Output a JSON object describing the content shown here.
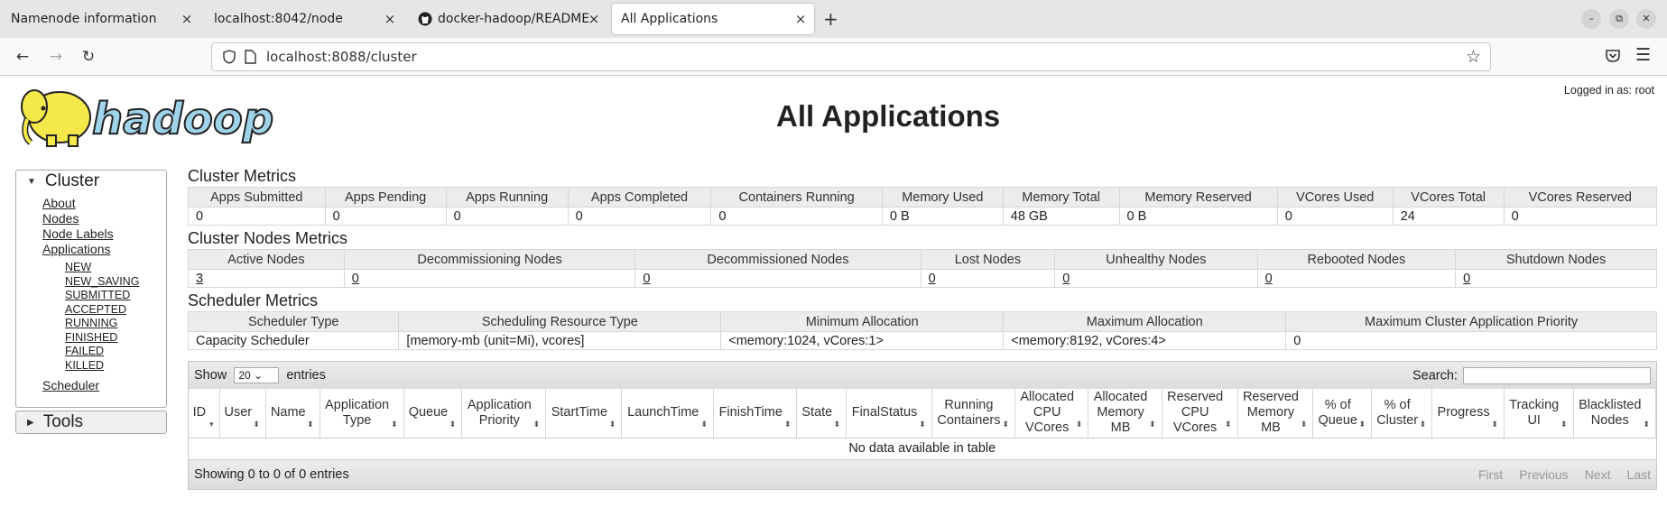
{
  "browser": {
    "tabs": [
      {
        "label": "Namenode information",
        "active": false
      },
      {
        "label": "localhost:8042/node",
        "active": false
      },
      {
        "label": "docker-hadoop/README",
        "active": false
      },
      {
        "label": "All Applications",
        "active": true
      }
    ],
    "close_glyph": "×",
    "new_tab_glyph": "+",
    "url": "localhost:8088/cluster"
  },
  "header": {
    "title": "All Applications",
    "logged_in": "Logged in as: root",
    "logo_text": "hadoop"
  },
  "sidebar": {
    "cluster_label": "Cluster",
    "links": [
      "About",
      "Nodes",
      "Node Labels",
      "Applications"
    ],
    "app_states": [
      "NEW",
      "NEW_SAVING",
      "SUBMITTED",
      "ACCEPTED",
      "RUNNING",
      "FINISHED",
      "FAILED",
      "KILLED"
    ],
    "scheduler_label": "Scheduler",
    "tools_label": "Tools"
  },
  "cluster_metrics": {
    "title": "Cluster Metrics",
    "headers": [
      "Apps Submitted",
      "Apps Pending",
      "Apps Running",
      "Apps Completed",
      "Containers Running",
      "Memory Used",
      "Memory Total",
      "Memory Reserved",
      "VCores Used",
      "VCores Total",
      "VCores Reserved"
    ],
    "values": [
      "0",
      "0",
      "0",
      "0",
      "0",
      "0 B",
      "48 GB",
      "0 B",
      "0",
      "24",
      "0"
    ]
  },
  "node_metrics": {
    "title": "Cluster Nodes Metrics",
    "headers": [
      "Active Nodes",
      "Decommissioning Nodes",
      "Decommissioned Nodes",
      "Lost Nodes",
      "Unhealthy Nodes",
      "Rebooted Nodes",
      "Shutdown Nodes"
    ],
    "values": [
      "3",
      "0",
      "0",
      "0",
      "0",
      "0",
      "0"
    ]
  },
  "scheduler_metrics": {
    "title": "Scheduler Metrics",
    "headers": [
      "Scheduler Type",
      "Scheduling Resource Type",
      "Minimum Allocation",
      "Maximum Allocation",
      "Maximum Cluster Application Priority"
    ],
    "values": [
      "Capacity Scheduler",
      "[memory-mb (unit=Mi), vcores]",
      "<memory:1024, vCores:1>",
      "<memory:8192, vCores:4>",
      "0"
    ]
  },
  "apps_table": {
    "show_label": "Show",
    "entries_label": "entries",
    "page_size": "20",
    "search_label": "Search:",
    "columns": [
      {
        "l1": "ID",
        "l2": "",
        "l3": ""
      },
      {
        "l1": "User",
        "l2": "",
        "l3": ""
      },
      {
        "l1": "Name",
        "l2": "",
        "l3": ""
      },
      {
        "l1": "Application",
        "l2": "Type",
        "l3": ""
      },
      {
        "l1": "Queue",
        "l2": "",
        "l3": ""
      },
      {
        "l1": "Application",
        "l2": "Priority",
        "l3": ""
      },
      {
        "l1": "StartTime",
        "l2": "",
        "l3": ""
      },
      {
        "l1": "LaunchTime",
        "l2": "",
        "l3": ""
      },
      {
        "l1": "FinishTime",
        "l2": "",
        "l3": ""
      },
      {
        "l1": "State",
        "l2": "",
        "l3": ""
      },
      {
        "l1": "FinalStatus",
        "l2": "",
        "l3": ""
      },
      {
        "l1": "Running",
        "l2": "Containers",
        "l3": ""
      },
      {
        "l1": "Allocated",
        "l2": "CPU",
        "l3": "VCores"
      },
      {
        "l1": "Allocated",
        "l2": "Memory",
        "l3": "MB"
      },
      {
        "l1": "Reserved",
        "l2": "CPU",
        "l3": "VCores"
      },
      {
        "l1": "Reserved",
        "l2": "Memory",
        "l3": "MB"
      },
      {
        "l1": "% of",
        "l2": "Queue",
        "l3": ""
      },
      {
        "l1": "% of",
        "l2": "Cluster",
        "l3": ""
      },
      {
        "l1": "Progress",
        "l2": "",
        "l3": ""
      },
      {
        "l1": "Tracking",
        "l2": "UI",
        "l3": ""
      },
      {
        "l1": "Blacklisted",
        "l2": "Nodes",
        "l3": ""
      }
    ],
    "empty_message": "No data available in table",
    "info": "Showing 0 to 0 of 0 entries",
    "pager": [
      "First",
      "Previous",
      "Next",
      "Last"
    ]
  }
}
